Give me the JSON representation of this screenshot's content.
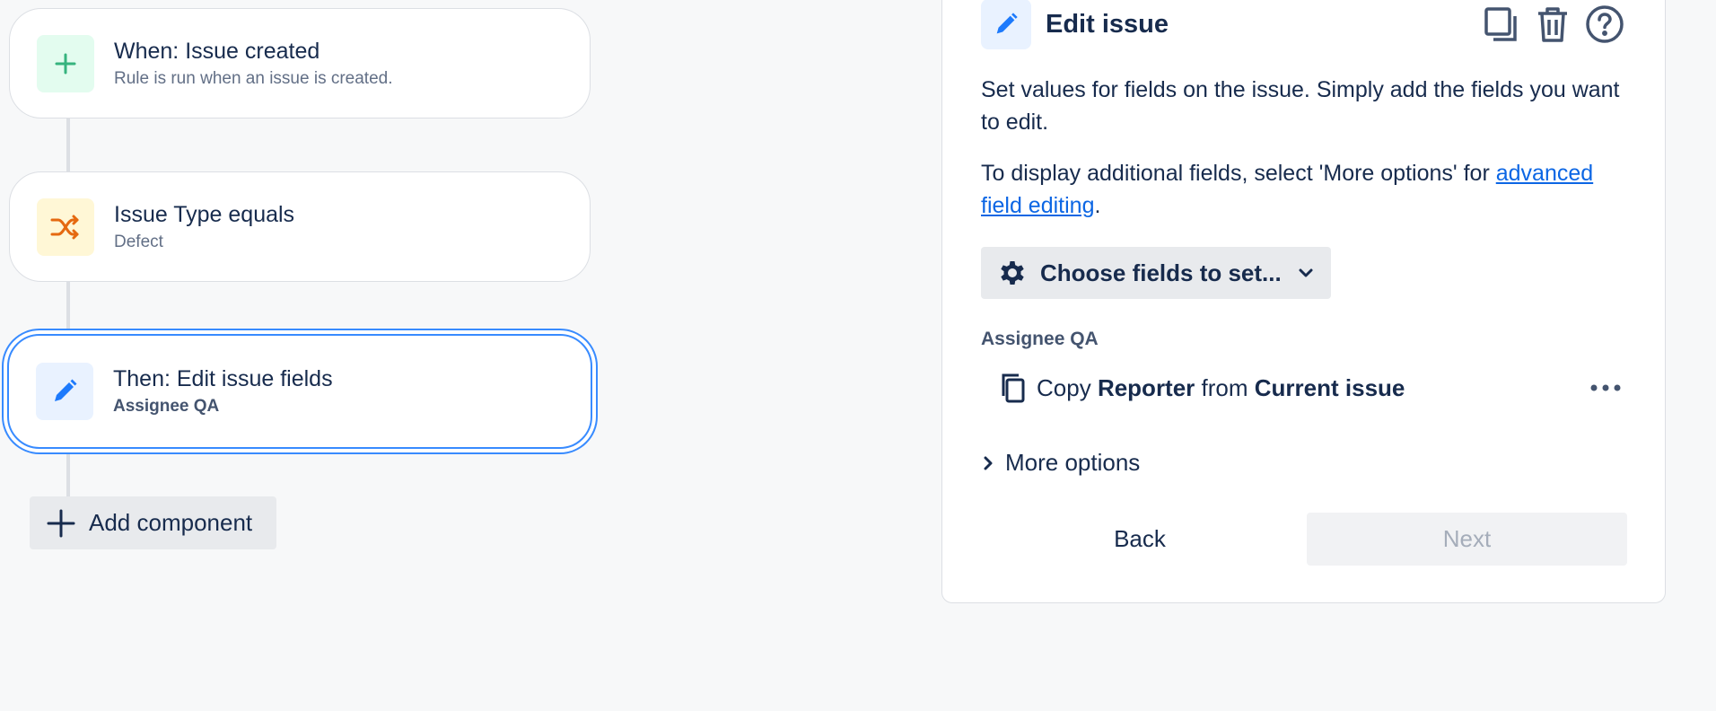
{
  "flow": {
    "trigger": {
      "title": "When: Issue created",
      "subtitle": "Rule is run when an issue is created.",
      "icon": "plus-icon"
    },
    "condition": {
      "title": "Issue Type equals",
      "subtitle": "Defect",
      "icon": "shuffle-icon"
    },
    "action": {
      "title": "Then: Edit issue fields",
      "subtitle": "Assignee QA",
      "icon": "pencil-icon"
    },
    "add_component_label": "Add component"
  },
  "panel": {
    "title": "Edit issue",
    "description_1": "Set values for fields on the issue. Simply add the fields you want to edit.",
    "description_2_prefix": "To display additional fields, select 'More options' for",
    "description_2_link": "advanced field editing",
    "description_2_suffix": ".",
    "choose_fields_label": "Choose fields to set...",
    "field": {
      "label": "Assignee QA",
      "verb": "Copy",
      "source_field": "Reporter",
      "preposition": "from",
      "source": "Current issue"
    },
    "more_options_label": "More options",
    "back_label": "Back",
    "next_label": "Next"
  },
  "colors": {
    "accent": "#388bff",
    "link": "#0c66e4",
    "trigger_icon": "#36b37e",
    "condition_icon": "#e56910",
    "action_icon": "#1d7afc"
  }
}
